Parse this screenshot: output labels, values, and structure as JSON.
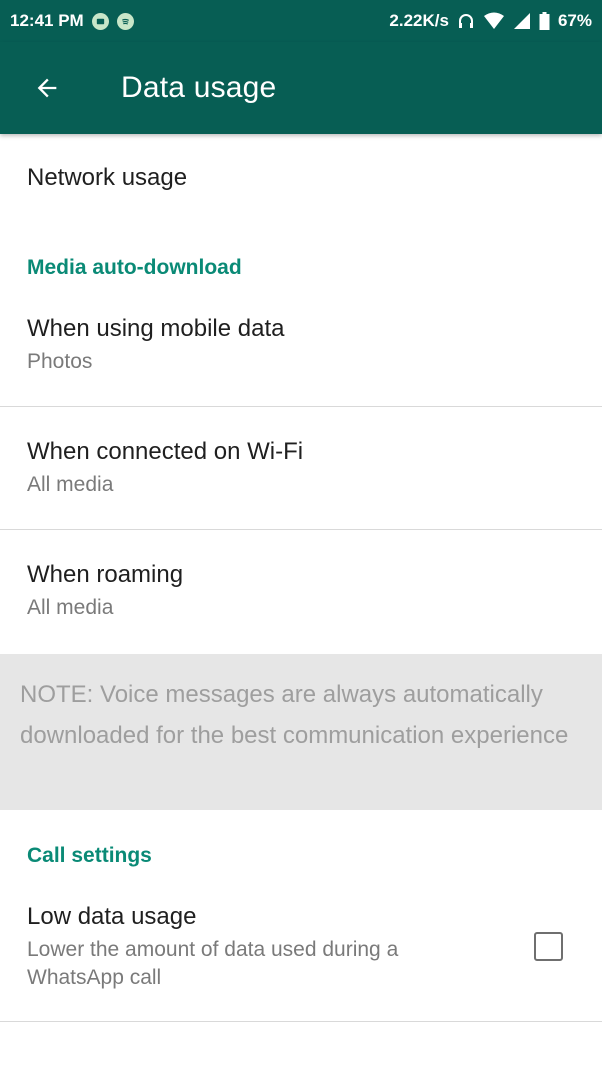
{
  "status_bar": {
    "time": "12:41 PM",
    "speed": "2.22K/s",
    "battery": "67%",
    "icons": [
      "message-icon",
      "spotify-icon",
      "headphones-icon",
      "wifi-icon",
      "signal-icon",
      "battery-icon"
    ]
  },
  "app_bar": {
    "title": "Data usage",
    "back_icon": "arrow-back-icon",
    "color": "#075e54"
  },
  "network_usage": {
    "label": "Network usage"
  },
  "media_auto_download": {
    "header": "Media auto-download",
    "items": [
      {
        "label": "When using mobile data",
        "value": "Photos"
      },
      {
        "label": "When connected on Wi-Fi",
        "value": "All media"
      },
      {
        "label": "When roaming",
        "value": "All media"
      }
    ],
    "note": "NOTE: Voice messages are always automatically downloaded for the best communication experience"
  },
  "call_settings": {
    "header": "Call settings",
    "low_data": {
      "label": "Low data usage",
      "description": "Lower the amount of data used during a WhatsApp call",
      "checked": false
    }
  },
  "colors": {
    "accent": "#0a8a76",
    "primary_dark": "#075e54"
  }
}
